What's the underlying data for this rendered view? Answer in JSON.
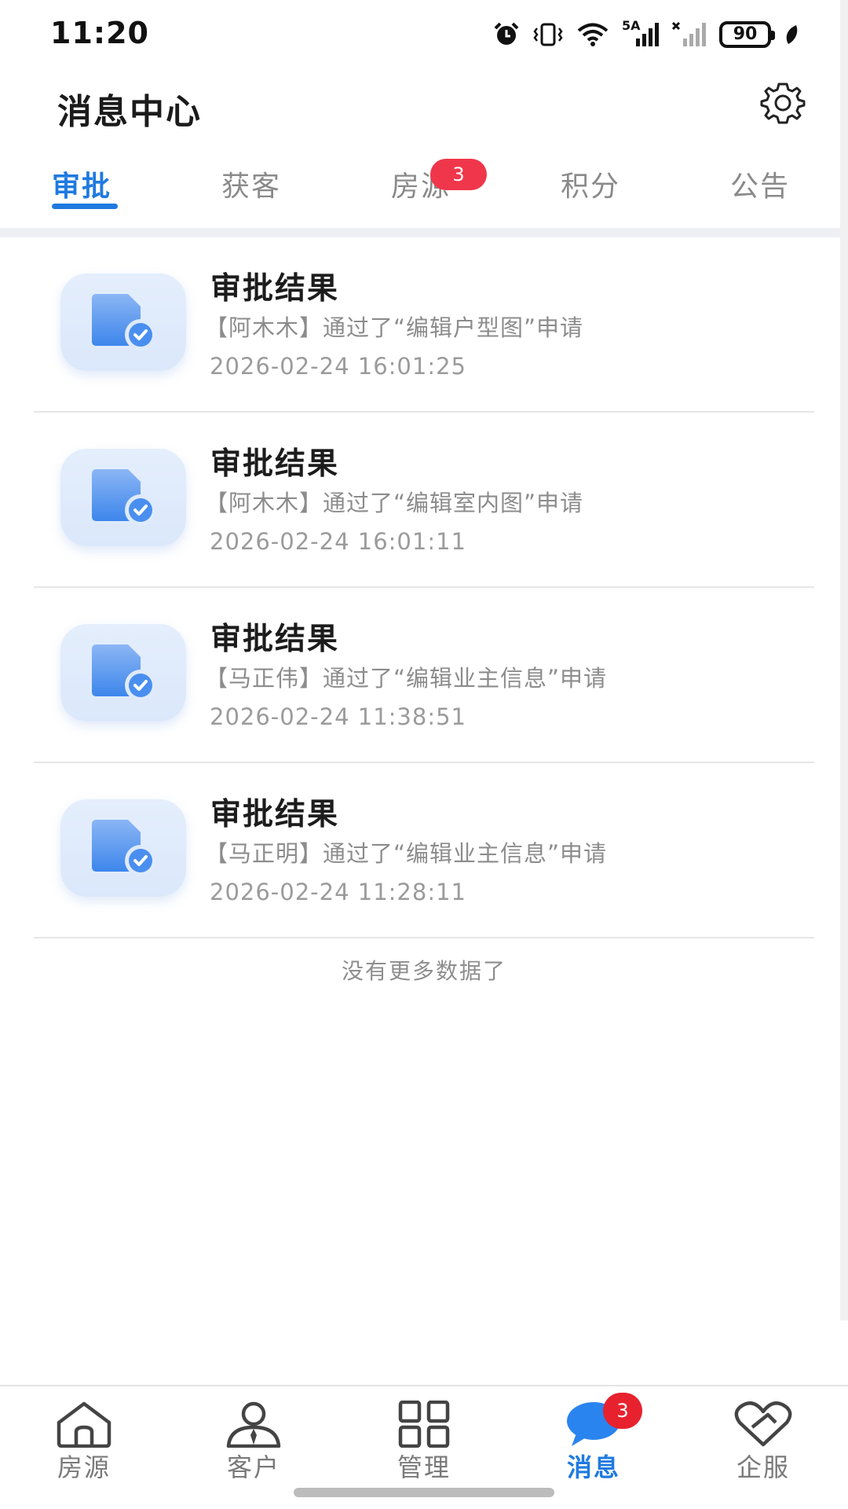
{
  "status_bar": {
    "time": "11:20",
    "battery": "90",
    "network_label": "5A",
    "icons": [
      "alarm-icon",
      "vibrate-icon",
      "wifi-icon",
      "signal-icon",
      "signal-off-icon",
      "battery-icon",
      "leaf-icon"
    ]
  },
  "header": {
    "title": "消息中心",
    "settings_icon": "gear-icon"
  },
  "tabs": [
    {
      "label": "审批",
      "active": true
    },
    {
      "label": "获客",
      "active": false
    },
    {
      "label": "房源",
      "active": false,
      "badge": "3"
    },
    {
      "label": "积分",
      "active": false
    },
    {
      "label": "公告",
      "active": false
    }
  ],
  "messages": [
    {
      "title": "审批结果",
      "desc": "【阿木木】通过了“编辑户型图”申请",
      "time": "2026-02-24 16:01:25",
      "icon": "approved-document-icon"
    },
    {
      "title": "审批结果",
      "desc": "【阿木木】通过了“编辑室内图”申请",
      "time": "2026-02-24 16:01:11",
      "icon": "approved-document-icon"
    },
    {
      "title": "审批结果",
      "desc": "【马正伟】通过了“编辑业主信息”申请",
      "time": "2026-02-24 11:38:51",
      "icon": "approved-document-icon"
    },
    {
      "title": "审批结果",
      "desc": "【马正明】通过了“编辑业主信息”申请",
      "time": "2026-02-24 11:28:11",
      "icon": "approved-document-icon"
    }
  ],
  "list_footer": "没有更多数据了",
  "bottom_nav": [
    {
      "label": "房源",
      "icon": "house-icon",
      "active": false
    },
    {
      "label": "客户",
      "icon": "person-icon",
      "active": false
    },
    {
      "label": "管理",
      "icon": "grid-icon",
      "active": false
    },
    {
      "label": "消息",
      "icon": "chat-bubble-icon",
      "active": true,
      "badge": "3"
    },
    {
      "label": "企服",
      "icon": "heart-handshake-icon",
      "active": false
    }
  ],
  "colors": {
    "accent": "#1f7ae0",
    "badge": "#f0364a",
    "muted_text": "#8c8c8c"
  }
}
